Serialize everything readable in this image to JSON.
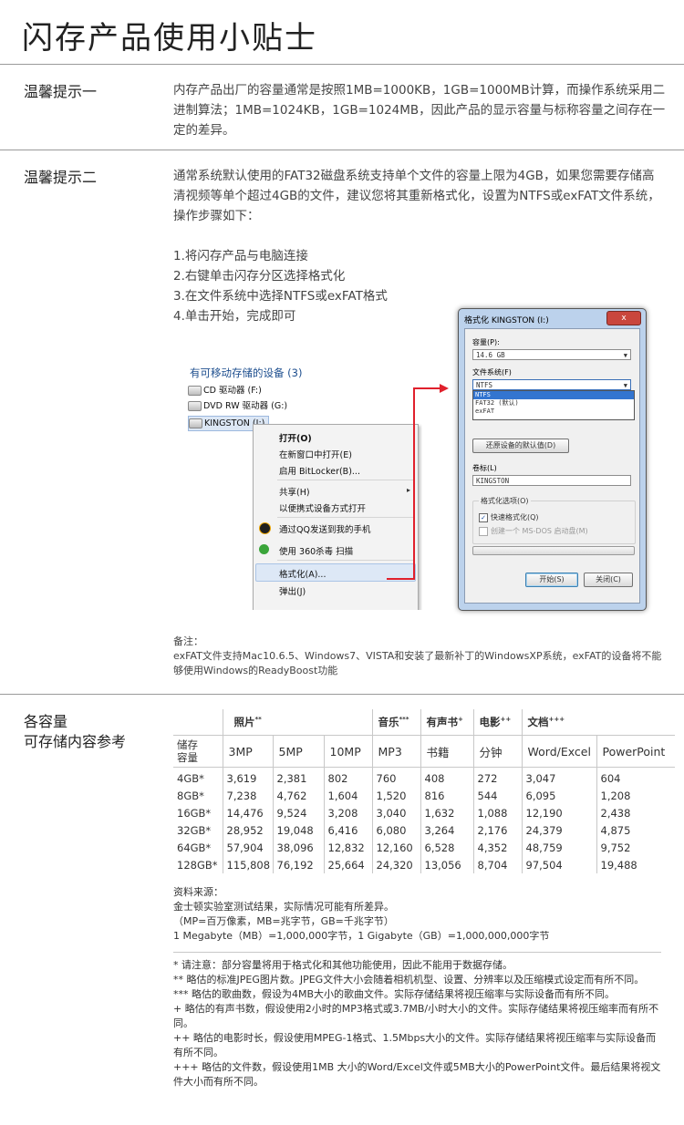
{
  "title": "闪存产品使用小贴士",
  "tip1": {
    "label": "温馨提示一",
    "text": "内存产品出厂的容量通常是按照1MB=1000KB，1GB=1000MB计算，而操作系统采用二进制算法；1MB=1024KB，1GB=1024MB，因此产品的显示容量与标称容量之间存在一定的差异。"
  },
  "tip2": {
    "label": "温馨提示二",
    "text": "通常系统默认使用的FAT32磁盘系统支持单个文件的容量上限为4GB，如果您需要存储高清视频等单个超过4GB的文件，建议您将其重新格式化，设置为NTFS或exFAT文件系统，操作步骤如下：",
    "steps": [
      "1.将闪存产品与电脑连接",
      "2.右键单击闪存分区选择格式化",
      "3.在文件系统中选择NTFS或exFAT格式",
      "4.单击开始，完成即可"
    ],
    "note_label": "备注：",
    "note_text": "exFAT文件支持Mac10.6.5、Windows7、VISTA和安装了最新补丁的WindowsXP系统，exFAT的设备将不能够使用Windows的ReadyBoost功能"
  },
  "explorer": {
    "header": "有可移动存储的设备 (3)",
    "drives": [
      "CD 驱动器 (F:)",
      "DVD RW 驱动器 (G:)",
      "KINGSTON (I:)"
    ],
    "menu": [
      "打开(O)",
      "在新窗口中打开(E)",
      "启用 BitLocker(B)...",
      "共享(H)",
      "以便携式设备方式打开",
      "通过QQ发送到我的手机",
      "使用 360杀毒 扫描",
      "格式化(A)...",
      "弹出(J)"
    ]
  },
  "dialog": {
    "title": "格式化 KINGSTON (I:)",
    "close": "x",
    "capacity_label": "容量(P):",
    "capacity_value": "14.6 GB",
    "fs_label": "文件系统(F)",
    "fs_value": "NTFS",
    "fs_options": [
      "NTFS",
      "FAT32 (默认)",
      "exFAT"
    ],
    "restore_button": "还原设备的默认值(D)",
    "volume_label": "卷标(L)",
    "volume_value": "KINGSTON",
    "options_label": "格式化选项(O)",
    "quick_format": "快速格式化(Q)",
    "msdos": "创建一个 MS-DOS 启动盘(M)",
    "start_button": "开始(S)",
    "close_button": "关闭(C)"
  },
  "capacity": {
    "label_line1": "各容量",
    "label_line2": "可存储内容参考",
    "groups": [
      {
        "name": "照片",
        "mark": "**"
      },
      {
        "name": "音乐",
        "mark": "***"
      },
      {
        "name": "有声书",
        "mark": "+"
      },
      {
        "name": "电影",
        "mark": "++"
      },
      {
        "name": "文档",
        "mark": "+++"
      }
    ],
    "cap_header_line1": "储存",
    "cap_header_line2": "容量",
    "columns": [
      "3MP",
      "5MP",
      "10MP",
      "MP3",
      "书籍",
      "分钟",
      "Word/Excel",
      "PowerPoint"
    ],
    "rows": [
      [
        "4GB*",
        "3,619",
        "2,381",
        "802",
        "760",
        "408",
        "272",
        "3,047",
        "604"
      ],
      [
        "8GB*",
        "7,238",
        "4,762",
        "1,604",
        "1,520",
        "816",
        "544",
        "6,095",
        "1,208"
      ],
      [
        "16GB*",
        "14,476",
        "9,524",
        "3,208",
        "3,040",
        "1,632",
        "1,088",
        "12,190",
        "2,438"
      ],
      [
        "32GB*",
        "28,952",
        "19,048",
        "6,416",
        "6,080",
        "3,264",
        "2,176",
        "24,379",
        "4,875"
      ],
      [
        "64GB*",
        "57,904",
        "38,096",
        "12,832",
        "12,160",
        "6,528",
        "4,352",
        "48,759",
        "9,752"
      ],
      [
        "128GB*",
        "115,808",
        "76,192",
        "25,664",
        "24,320",
        "13,056",
        "8,704",
        "97,504",
        "19,488"
      ]
    ],
    "sources": [
      "资料来源：",
      "金士顿实验室测试结果，实际情况可能有所差异。",
      "（MP=百万像素，MB=兆字节，GB=千兆字节）",
      "1 Megabyte（MB）=1,000,000字节，1 Gigabyte（GB）=1,000,000,000字节"
    ],
    "footnotes": [
      "* 请注意：部分容量将用于格式化和其他功能使用，因此不能用于数据存储。",
      "** 略估的标准JPEG图片数。JPEG文件大小会随着相机机型、设置、分辨率以及压缩模式设定而有所不同。",
      "*** 略估的歌曲数，假设为4MB大小的歌曲文件。实际存储结果将视压缩率与实际设备而有所不同。",
      "+ 略估的有声书数，假设使用2小时的MP3格式或3.7MB/小时大小的文件。实际存储结果将视压缩率而有所不同。",
      "++ 略估的电影时长，假设使用MPEG-1格式、1.5Mbps大小的文件。实际存储结果将视压缩率与实际设备而有所不同。",
      "+++ 略估的文件数，假设使用1MB 大小的Word/Excel文件或5MB大小的PowerPoint文件。最后结果将视文件大小而有所不同。"
    ]
  }
}
